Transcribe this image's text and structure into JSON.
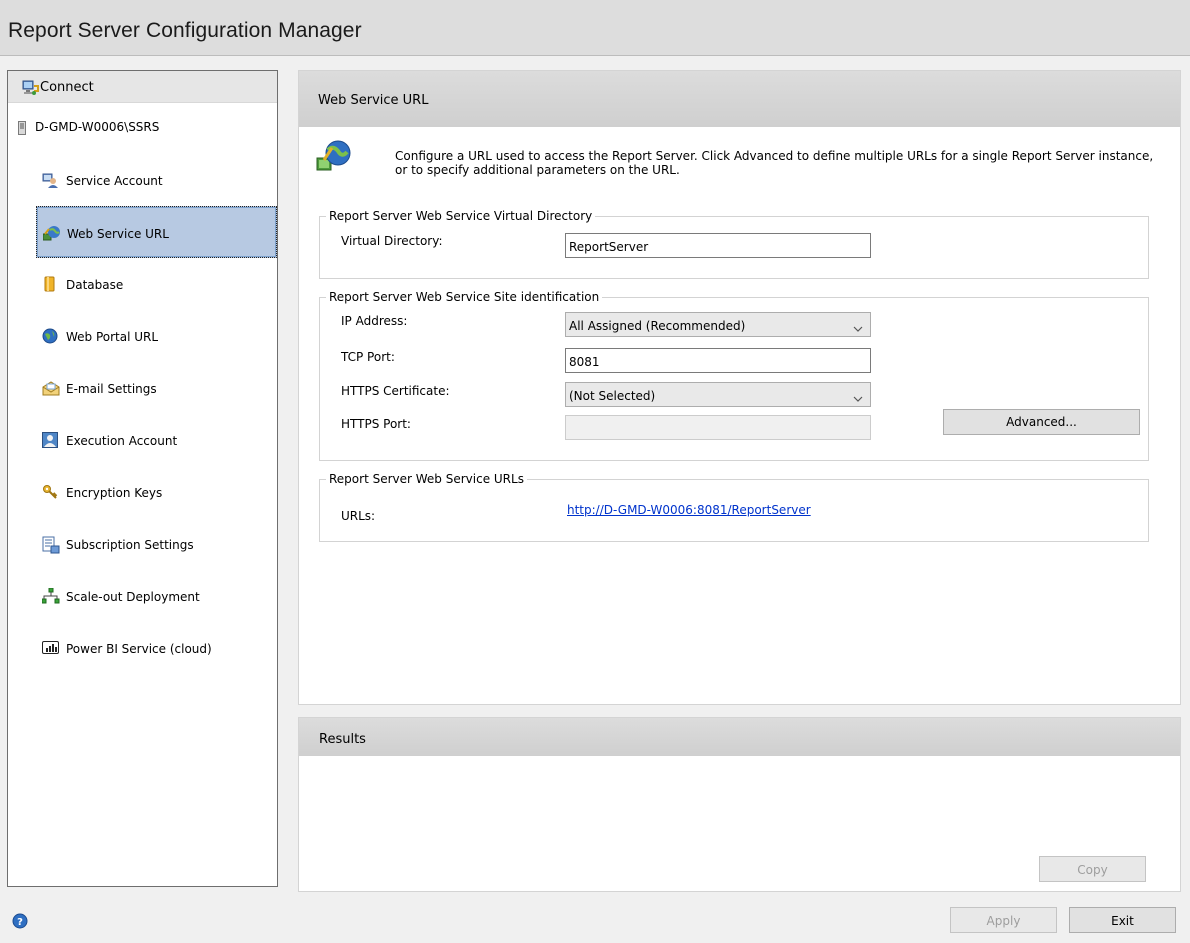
{
  "window": {
    "title": "Report Server Configuration Manager"
  },
  "sidebar": {
    "connect_label": "Connect",
    "server_name": "D-GMD-W0006\\SSRS",
    "items": [
      {
        "label": "Service Account",
        "icon": "service-account-icon"
      },
      {
        "label": "Web Service URL",
        "icon": "web-service-url-icon",
        "selected": true
      },
      {
        "label": "Database",
        "icon": "database-icon"
      },
      {
        "label": "Web Portal URL",
        "icon": "globe-icon"
      },
      {
        "label": "E-mail Settings",
        "icon": "email-icon"
      },
      {
        "label": "Execution Account",
        "icon": "user-account-icon"
      },
      {
        "label": "Encryption Keys",
        "icon": "keys-icon"
      },
      {
        "label": "Subscription Settings",
        "icon": "subscription-icon"
      },
      {
        "label": "Scale-out Deployment",
        "icon": "network-icon"
      },
      {
        "label": "Power BI Service (cloud)",
        "icon": "powerbi-icon"
      }
    ]
  },
  "main": {
    "header": "Web Service URL",
    "intro": "Configure a URL used to access the Report Server.  Click Advanced to define multiple URLs for a single Report Server instance, or to specify additional parameters on the URL.",
    "virtual_directory_group": {
      "legend": "Report Server Web Service Virtual Directory",
      "label": "Virtual Directory:",
      "value": "ReportServer"
    },
    "site_identification_group": {
      "legend": "Report Server Web Service Site identification",
      "ip_label": "IP Address:",
      "ip_value": "All Assigned (Recommended)",
      "tcp_label": "TCP Port:",
      "tcp_value": "8081",
      "cert_label": "HTTPS Certificate:",
      "cert_value": "(Not Selected)",
      "https_port_label": "HTTPS Port:",
      "https_port_value": "",
      "advanced_label": "Advanced..."
    },
    "urls_group": {
      "legend": "Report Server Web Service URLs",
      "label": "URLs:",
      "url": "http://D-GMD-W0006:8081/ReportServer"
    }
  },
  "results": {
    "header": "Results",
    "copy_label": "Copy"
  },
  "footer": {
    "apply_label": "Apply",
    "exit_label": "Exit"
  },
  "colors": {
    "selection_bg": "#b7c9e2",
    "link": "#0033cc",
    "header_bg": "#d6d6d6"
  }
}
